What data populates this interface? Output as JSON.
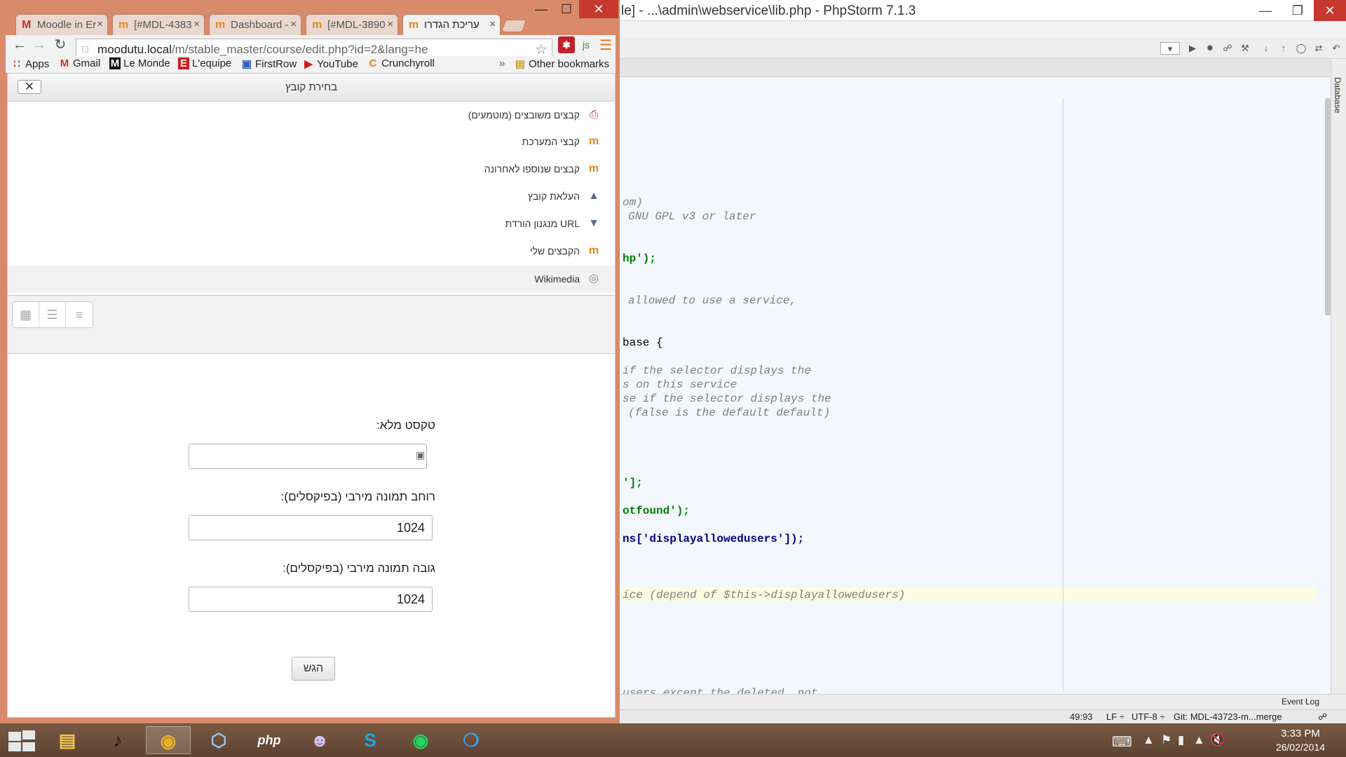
{
  "ide": {
    "title": "le] - ...\\admin\\webservice\\lib.php - PhpStorm 7.1.3",
    "database_tab": "Database",
    "event_log": "Event Log",
    "code_lines": [
      {
        "text": "om)",
        "kind": "comment"
      },
      {
        "text": "GNU GPL v3 or later",
        "kind": "comment"
      },
      {
        "text": "hp');",
        "kind": "string"
      },
      {
        "text": "allowed to use a service,",
        "kind": "comment"
      },
      {
        "text": "base {",
        "kind": "plain"
      },
      {
        "text": "if the selector displays the",
        "kind": "comment"
      },
      {
        "text": "s on this service",
        "kind": "comment"
      },
      {
        "text": "se if the selector displays the",
        "kind": "comment"
      },
      {
        "text": "(false is the default default)",
        "kind": "comment"
      },
      {
        "text": "'];",
        "kind": "string"
      },
      {
        "text": "otfound');",
        "kind": "string"
      },
      {
        "text": "ns['displayallowedusers']);",
        "kind": "mixed"
      },
      {
        "text": "ice (depend of $this->displayallowedusers)",
        "kind": "comment"
      },
      {
        "text": "users except the deleted, not",
        "kind": "comment"
      }
    ],
    "status": {
      "position": "49:93",
      "line_sep": "LF ÷",
      "encoding": "UTF-8 ÷",
      "vcs": "Git: MDL-43723-m...merge"
    }
  },
  "browser": {
    "tabs": [
      {
        "title": "Moodle in Er",
        "favicon": "gmail-icon"
      },
      {
        "title": "[#MDL-4383",
        "favicon": "moodle-icon"
      },
      {
        "title": "Dashboard -",
        "favicon": "moodle-icon"
      },
      {
        "title": "[#MDL-3890",
        "favicon": "moodle-icon"
      },
      {
        "title": "עריכת הגדרו",
        "favicon": "moodle-icon"
      }
    ],
    "url": {
      "host": "moodutu.local",
      "path": "/m/stable_master/course/edit.php?id=2&lang=he"
    },
    "bookmarks": [
      "Apps",
      "Gmail",
      "Le Monde",
      "L'equipe",
      "FirstRow",
      "YouTube",
      "Crunchyroll"
    ],
    "bookmarks_overflow": "»",
    "other_bookmarks": "Other bookmarks"
  },
  "picker": {
    "title": "בחירת קובץ",
    "repositories": [
      {
        "label": "קבצים משובצים (מוטמעים)",
        "icon": "embedded-files-icon"
      },
      {
        "label": "קבצי המערכת",
        "icon": "moodle-icon"
      },
      {
        "label": "קבצים שנוספו לאחרונה",
        "icon": "moodle-icon"
      },
      {
        "label": "העלאת קובץ",
        "icon": "upload-icon"
      },
      {
        "label": "URL מנגנון הורדת",
        "icon": "download-icon"
      },
      {
        "label": "הקבצים שלי",
        "icon": "moodle-icon"
      },
      {
        "label": "Wikimedia",
        "icon": "wikimedia-icon"
      }
    ],
    "selected_repository": 6,
    "form": {
      "alt_label": "טקסט מלא:",
      "alt_value": "",
      "width_label": "רוחב תמונה מירבי (בפיקסלים):",
      "width_value": "1024",
      "height_label": "גובה תמונה מירבי (בפיקסלים):",
      "height_value": "1024",
      "submit_label": "הגש"
    }
  },
  "taskbar": {
    "time": "3:33 PM",
    "date": "26/02/2014"
  }
}
